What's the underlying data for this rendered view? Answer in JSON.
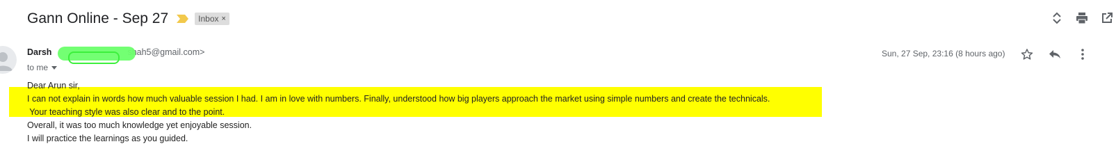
{
  "email": {
    "subject": "Gann Online - Sep 27",
    "label": "Inbox",
    "label_close": "×",
    "sender_name": "Darsh",
    "sender_email_fragment": "shah5@gmail.com>",
    "recipient": "to me",
    "date": "Sun, 27 Sep, 23:16 (8 hours ago)",
    "body": {
      "line1": "Dear Arun sir,",
      "line2": "I can not explain in words how much valuable session I had. I am in love with numbers. Finally, understood how big players approach the market using simple numbers and create the technicals.",
      "line3": " Your teaching style was also clear and to the point.",
      "line4": "Overall, it was too much knowledge yet enjoyable session.",
      "line5": "I will practice the learnings as you guided."
    }
  },
  "colors": {
    "highlight": "#ffff00",
    "importance_marker": "#f2c94c",
    "redaction": "#6cff6c"
  },
  "icons": {
    "importance": "label-important-icon",
    "expand": "unfold-more-icon",
    "print": "print-icon",
    "popout": "open-in-new-icon",
    "avatar": "person-icon",
    "dropdown": "caret-down-icon",
    "star": "star-icon",
    "reply": "reply-icon",
    "more": "more-vert-icon"
  }
}
